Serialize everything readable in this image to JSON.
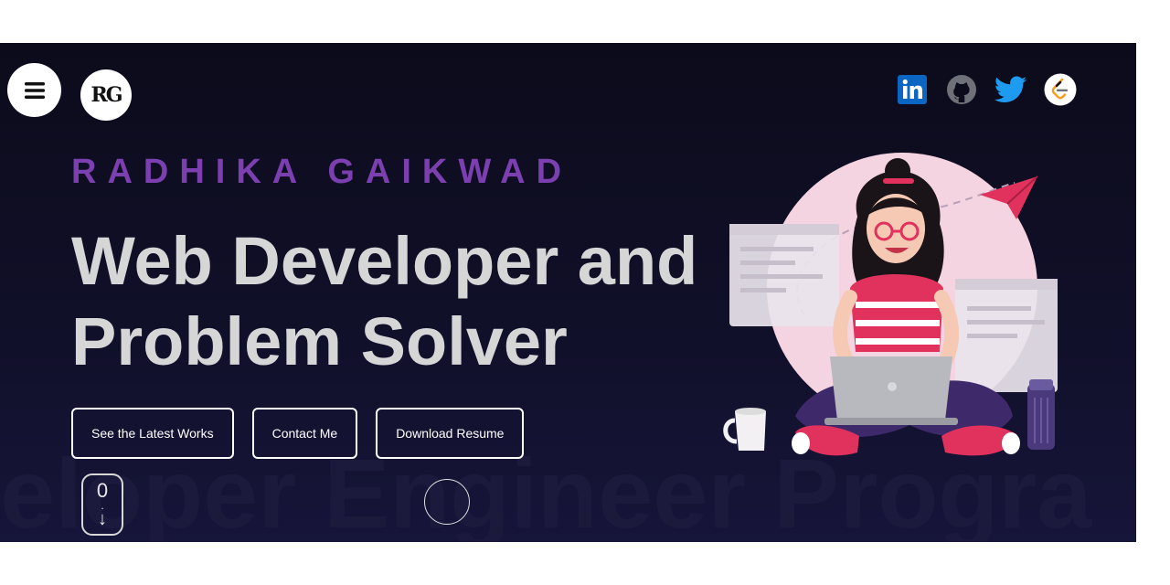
{
  "header": {
    "menu_icon": "hamburger-icon",
    "logo_text": "RG",
    "socials": [
      {
        "name": "linkedin",
        "icon": "linkedin-icon",
        "color": "#0a66c2"
      },
      {
        "name": "github",
        "icon": "github-icon",
        "color": "#6e7177"
      },
      {
        "name": "twitter",
        "icon": "twitter-icon",
        "color": "#1d9bf0"
      },
      {
        "name": "leetcode",
        "icon": "leetcode-icon",
        "color": "#f89f1b"
      }
    ]
  },
  "hero": {
    "name": "RADHIKA GAIKWAD",
    "headline_line1": "Web Developer and",
    "headline_line2": "Problem Solver",
    "buttons": {
      "latest_works": "See the Latest Works",
      "contact": "Contact Me",
      "resume": "Download Resume"
    },
    "background_marquee": "veloper Engineer Progra",
    "scroll_indicator": {
      "top": "0",
      "middle": ".",
      "arrow": "↓"
    }
  },
  "colors": {
    "background": "#0c0b1b",
    "accent": "#7b3fb0",
    "headline": "#d6d6d6"
  }
}
